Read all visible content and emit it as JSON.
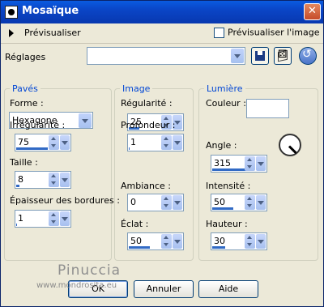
{
  "window": {
    "title": "Mosaïque",
    "close_glyph": "✕"
  },
  "preview": {
    "label": "Prévisualiser",
    "image_label": "Prévisualiser l'image",
    "image_checked": false
  },
  "presets": {
    "label": "Réglages",
    "value": ""
  },
  "paves": {
    "legend": "Pavés",
    "forme_label": "Forme :",
    "forme_value": "Hexagone",
    "irregularite_label": "Irrégularité :",
    "irregularite_value": "75",
    "irregularite_fill": 0.75,
    "taille_label": "Taille :",
    "taille_value": "8",
    "taille_fill": 0.08,
    "epaisseur_label": "Épaisseur des bordures :",
    "epaisseur_value": "1",
    "epaisseur_fill": 0.02
  },
  "image": {
    "legend": "Image",
    "regularite_label": "Régularité :",
    "regularite_value": "25",
    "regularite_fill": 0.25,
    "profondeur_label": "Profondeur :",
    "profondeur_value": "1",
    "profondeur_fill": 0.02,
    "ambiance_label": "Ambiance :",
    "ambiance_value": "0",
    "ambiance_fill": 0.0,
    "eclat_label": "Éclat :",
    "eclat_value": "50",
    "eclat_fill": 0.5
  },
  "lumiere": {
    "legend": "Lumière",
    "couleur_label": "Couleur :",
    "couleur_value": "#ffffff",
    "angle_label": "Angle :",
    "angle_value": "315",
    "angle_fill": 0.875,
    "intensite_label": "Intensité :",
    "intensite_value": "50",
    "intensite_fill": 0.5,
    "hauteur_label": "Hauteur :",
    "hauteur_value": "30",
    "hauteur_fill": 0.3
  },
  "buttons": {
    "ok": "OK",
    "cancel": "Annuler",
    "help": "Aide"
  },
  "watermark": {
    "name": "Pinuccia",
    "url": "www.mondrosita.eu"
  },
  "colors": {
    "accent": "#316ac5",
    "title_bar": "#0a45c6",
    "legend": "#0046d5",
    "face": "#ece9d8"
  }
}
